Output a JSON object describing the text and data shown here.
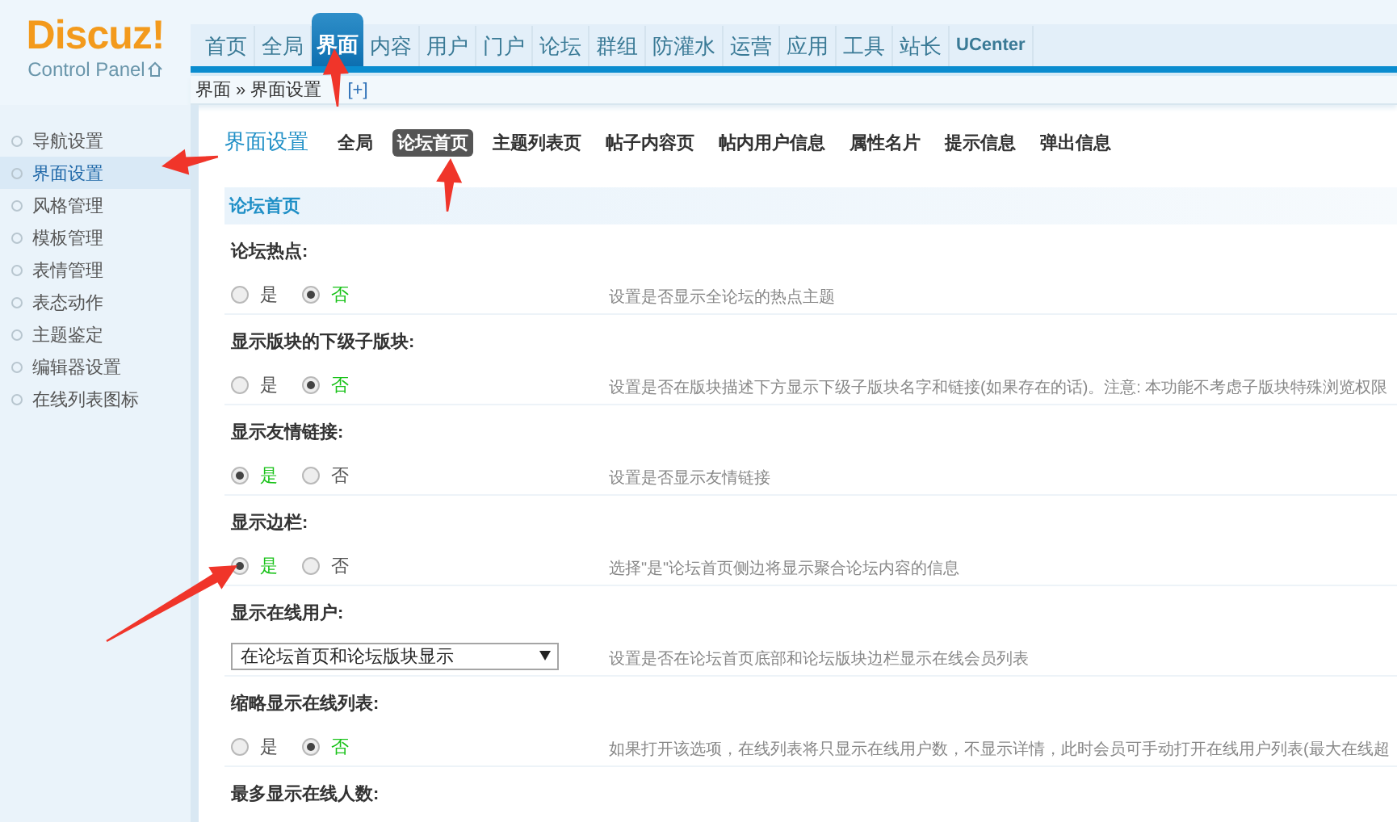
{
  "logo": {
    "brand": "Discuz!",
    "subtitle": "Control Panel"
  },
  "nav": [
    {
      "label": "首页",
      "selected": false
    },
    {
      "label": "全局",
      "selected": false
    },
    {
      "label": "界面",
      "selected": true
    },
    {
      "label": "内容",
      "selected": false
    },
    {
      "label": "用户",
      "selected": false
    },
    {
      "label": "门户",
      "selected": false
    },
    {
      "label": "论坛",
      "selected": false
    },
    {
      "label": "群组",
      "selected": false
    },
    {
      "label": "防灌水",
      "selected": false
    },
    {
      "label": "运营",
      "selected": false
    },
    {
      "label": "应用",
      "selected": false
    },
    {
      "label": "工具",
      "selected": false
    },
    {
      "label": "站长",
      "selected": false
    },
    {
      "label": "UCenter",
      "selected": false
    }
  ],
  "breadcrumb": {
    "path": "界面 » 界面设置",
    "toggle": "[+]"
  },
  "sidebar": {
    "items": [
      {
        "label": "导航设置",
        "selected": false
      },
      {
        "label": "界面设置",
        "selected": true
      },
      {
        "label": "风格管理",
        "selected": false
      },
      {
        "label": "模板管理",
        "selected": false
      },
      {
        "label": "表情管理",
        "selected": false
      },
      {
        "label": "表态动作",
        "selected": false
      },
      {
        "label": "主题鉴定",
        "selected": false
      },
      {
        "label": "编辑器设置",
        "selected": false
      },
      {
        "label": "在线列表图标",
        "selected": false
      }
    ]
  },
  "page_title": "界面设置",
  "subtabs": [
    {
      "label": "全局",
      "selected": false
    },
    {
      "label": "论坛首页",
      "selected": true
    },
    {
      "label": "主题列表页",
      "selected": false
    },
    {
      "label": "帖子内容页",
      "selected": false
    },
    {
      "label": "帖内用户信息",
      "selected": false
    },
    {
      "label": "属性名片",
      "selected": false
    },
    {
      "label": "提示信息",
      "selected": false
    },
    {
      "label": "弹出信息",
      "selected": false
    }
  ],
  "section": {
    "title": "论坛首页",
    "settings": [
      {
        "kind": "radio",
        "title": "论坛热点:",
        "options": [
          {
            "label": "是",
            "selected": false
          },
          {
            "label": "否",
            "selected": true
          }
        ],
        "description": "设置是否显示全论坛的热点主题"
      },
      {
        "kind": "radio",
        "title": "显示版块的下级子版块:",
        "options": [
          {
            "label": "是",
            "selected": false
          },
          {
            "label": "否",
            "selected": true
          }
        ],
        "description": "设置是否在版块描述下方显示下级子版块名字和链接(如果存在的话)。注意: 本功能不考虑子版块特殊浏览权限"
      },
      {
        "kind": "radio",
        "title": "显示友情链接:",
        "options": [
          {
            "label": "是",
            "selected": true
          },
          {
            "label": "否",
            "selected": false
          }
        ],
        "description": "设置是否显示友情链接"
      },
      {
        "kind": "radio",
        "title": "显示边栏:",
        "options": [
          {
            "label": "是",
            "selected": true
          },
          {
            "label": "否",
            "selected": false
          }
        ],
        "description": "选择\"是\"论坛首页侧边将显示聚合论坛内容的信息"
      },
      {
        "kind": "select",
        "title": "显示在线用户:",
        "value": "在论坛首页和论坛版块显示",
        "description": "设置是否在论坛首页底部和论坛版块边栏显示在线会员列表"
      },
      {
        "kind": "radio",
        "title": "缩略显示在线列表:",
        "options": [
          {
            "label": "是",
            "selected": false
          },
          {
            "label": "否",
            "selected": true
          }
        ],
        "description": "如果打开该选项，在线列表将只显示在线用户数，不显示详情，此时会员可手动打开在线用户列表(最大在线超"
      },
      {
        "kind": "heading",
        "title": "最多显示在线人数:"
      }
    ]
  }
}
